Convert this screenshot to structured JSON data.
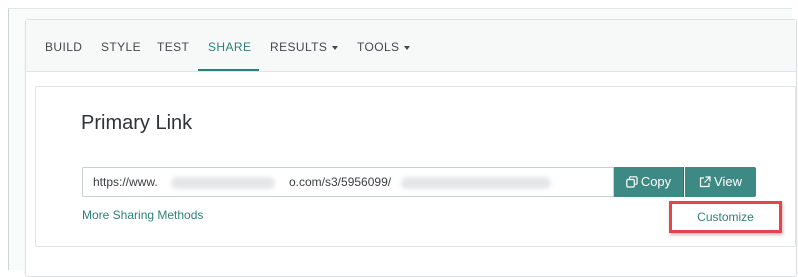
{
  "nav": {
    "items": [
      {
        "label": "BUILD"
      },
      {
        "label": "STYLE"
      },
      {
        "label": "TEST"
      },
      {
        "label": "SHARE"
      },
      {
        "label": "RESULTS"
      },
      {
        "label": "TOOLS"
      }
    ],
    "active_item": "SHARE"
  },
  "share": {
    "title": "Primary Link",
    "url_start": "https://www.",
    "url_middle": "o.com/s3/5956099/",
    "copy_label": "Copy",
    "view_label": "View",
    "more_methods_label": "More Sharing Methods",
    "customize_label": "Customize"
  },
  "colors": {
    "accent": "#2e7f79",
    "button": "#3d8a84",
    "highlight": "#e4454b"
  },
  "icons": {
    "copy": "copy-icon",
    "view": "external-link-icon",
    "dropdown": "caret-down-icon"
  }
}
